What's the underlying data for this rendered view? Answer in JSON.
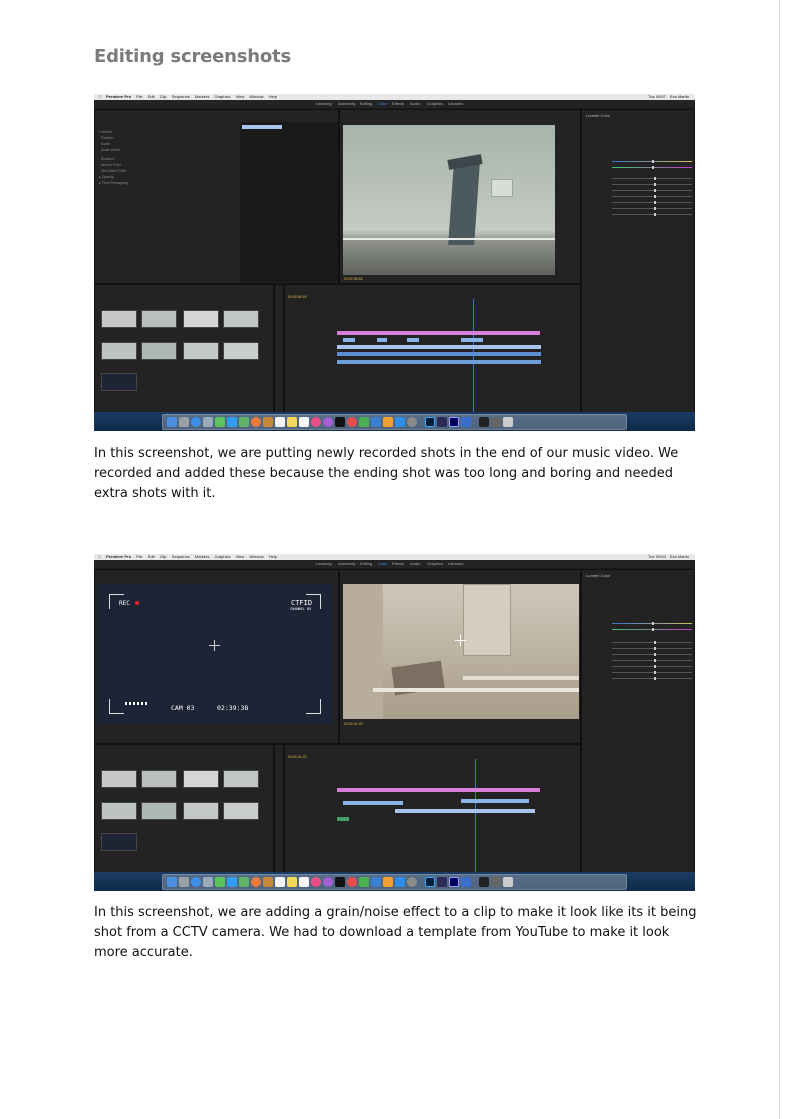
{
  "heading": "Editing screenshots",
  "captions": [
    "In this screenshot, we are putting newly recorded shots in the end of our music video. We recorded and added these because the ending shot was too long and boring and needed extra shots with it.",
    "In this screenshot, we are adding a grain/noise effect to a clip to make it look like its it being shot from a CCTV camera. We had to download a template from YouTube to make it look more accurate."
  ],
  "screenshots": [
    {
      "app_name": "Premiere Pro",
      "menu": [
        "File",
        "Edit",
        "Clip",
        "Sequence",
        "Markers",
        "Graphics",
        "View",
        "Window",
        "Help"
      ],
      "clock": "Tue 09:57",
      "user": "Eva Martin",
      "workspaces": [
        "Learning",
        "Assembly",
        "Editing",
        "Color",
        "Effects",
        "Audio",
        "Graphics",
        "Libraries"
      ],
      "active_workspace": "Color",
      "panel_label": "Lumetri Color",
      "program_timecode": "00:02:55:18",
      "timeline_timecode": "00:02:55:18"
    },
    {
      "app_name": "Premiere Pro",
      "menu": [
        "File",
        "Edit",
        "Clip",
        "Sequence",
        "Markers",
        "Graphics",
        "View",
        "Window",
        "Help"
      ],
      "clock": "Tue 09:53",
      "user": "Eva Martin",
      "workspaces": [
        "Learning",
        "Assembly",
        "Editing",
        "Color",
        "Effects",
        "Audio",
        "Graphics",
        "Libraries"
      ],
      "active_workspace": "Color",
      "panel_label": "Lumetri Color",
      "cctv": {
        "rec": "REC",
        "brand": "CTFID",
        "channel": "CHANNEL 05",
        "cam": "CAM 03",
        "time": "02:39:38"
      },
      "program_timecode": "00:02:41:23",
      "timeline_timecode": "00:02:41:23"
    }
  ]
}
